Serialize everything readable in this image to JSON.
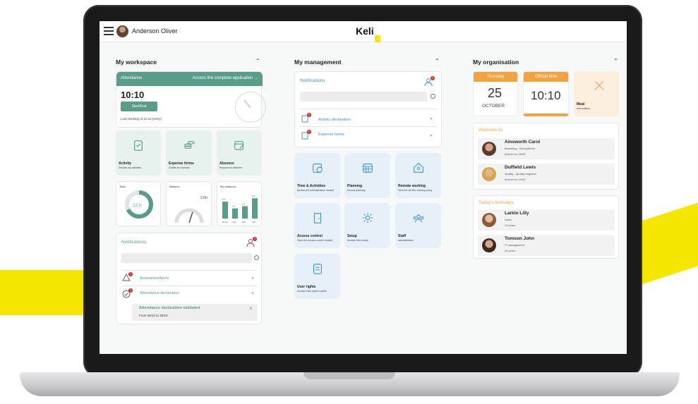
{
  "topbar": {
    "username": "Anderson Oliver",
    "logo": "Keli",
    "logo_mark": "o"
  },
  "workspace": {
    "title": "My workspace",
    "attendance": {
      "header": "Attendance",
      "link": "Access the complete application",
      "link_arrow": "→",
      "time": "10:10",
      "button": "Start/End",
      "last": "Last clocking at 10:10 (entry)"
    },
    "tiles": [
      {
        "title": "Activity",
        "sub": "Declare my activities",
        "icon": "clipboard-icon"
      },
      {
        "title": "Expense forms",
        "sub": "Create an expense",
        "icon": "coins-icon"
      },
      {
        "title": "Absence",
        "sub": "Request an absence",
        "icon": "calendar-edit-icon"
      }
    ],
    "total": {
      "label": "Total",
      "value": "12 h",
      "progress": 0.68
    },
    "balance": {
      "label": "Balance",
      "value": "2.5h",
      "level": 0.6
    },
    "balances": {
      "label": "My balances",
      "bars": [
        0.75,
        0.45,
        0.55,
        0.9
      ],
      "tops": [
        "0.0",
        "0.0",
        "0.0",
        "0.0"
      ],
      "names": [
        "Hours",
        "Abs.",
        "Abs.",
        "Vac."
      ]
    },
    "notifications": {
      "title": "Notifications",
      "count": "2",
      "items": [
        {
          "label": "Anomalies/Alerts",
          "badge": "1",
          "chev": "⌄"
        },
        {
          "label": "Attendance declaration",
          "badge": "1",
          "chev": "⌃"
        }
      ],
      "detail_title": "Attendance declaration validated",
      "detail_sub": "From 25/10 to 30/10",
      "close": "×"
    }
  },
  "management": {
    "title": "My management",
    "notifications": {
      "title": "Notifications",
      "count": "4",
      "items": [
        {
          "label": "Activity declaration",
          "badge": "1"
        },
        {
          "label": "Expense forms",
          "badge": "2"
        }
      ]
    },
    "tiles": [
      {
        "title": "Time & Activities",
        "sub": "Access the administration module",
        "icon": "calendar-clock-icon"
      },
      {
        "title": "Planning",
        "sub": "Access planning",
        "icon": "grid-calendar-icon"
      },
      {
        "title": "Remote working",
        "sub": "View the remote working policy",
        "icon": "home-user-icon"
      },
      {
        "title": "Access control",
        "sub": "Open the access control module",
        "icon": "door-icon"
      },
      {
        "title": "Setup",
        "sub": "Access Kelio setup",
        "icon": "gear-icon"
      },
      {
        "title": "Staff",
        "sub": "administration",
        "icon": "team-icon"
      },
      {
        "title": "User rights",
        "sub": "Access Kelio rights module",
        "icon": "checklist-icon"
      }
    ]
  },
  "organisation": {
    "title": "My organisation",
    "date": {
      "head": "Thursday",
      "day": "25",
      "month": "OCTOBER"
    },
    "time": {
      "head": "Official time",
      "value": "10:10"
    },
    "meal": {
      "title": "Meal",
      "sub": "reservations"
    },
    "welcome": {
      "title": "Welcome to",
      "people": [
        {
          "name": "Ainsworth Carol",
          "role": "Marketing - Receptionist",
          "note": "Arrived on 20/10"
        },
        {
          "name": "Duffield Lewis",
          "role": "Quality - Quality engineer",
          "note": "Arrived on 24/10"
        }
      ]
    },
    "birthdays": {
      "title": "Today's birthdays",
      "people": [
        {
          "name": "Larkin Lilly",
          "role": "Sales",
          "note": "33 years"
        },
        {
          "name": "Tomson John",
          "role": "IT management",
          "note": "26 years"
        }
      ]
    }
  },
  "colors": {
    "green": "#5a9c8a",
    "orange": "#f2a341",
    "blue": "#3a8fd6",
    "yellow": "#f5e600"
  }
}
